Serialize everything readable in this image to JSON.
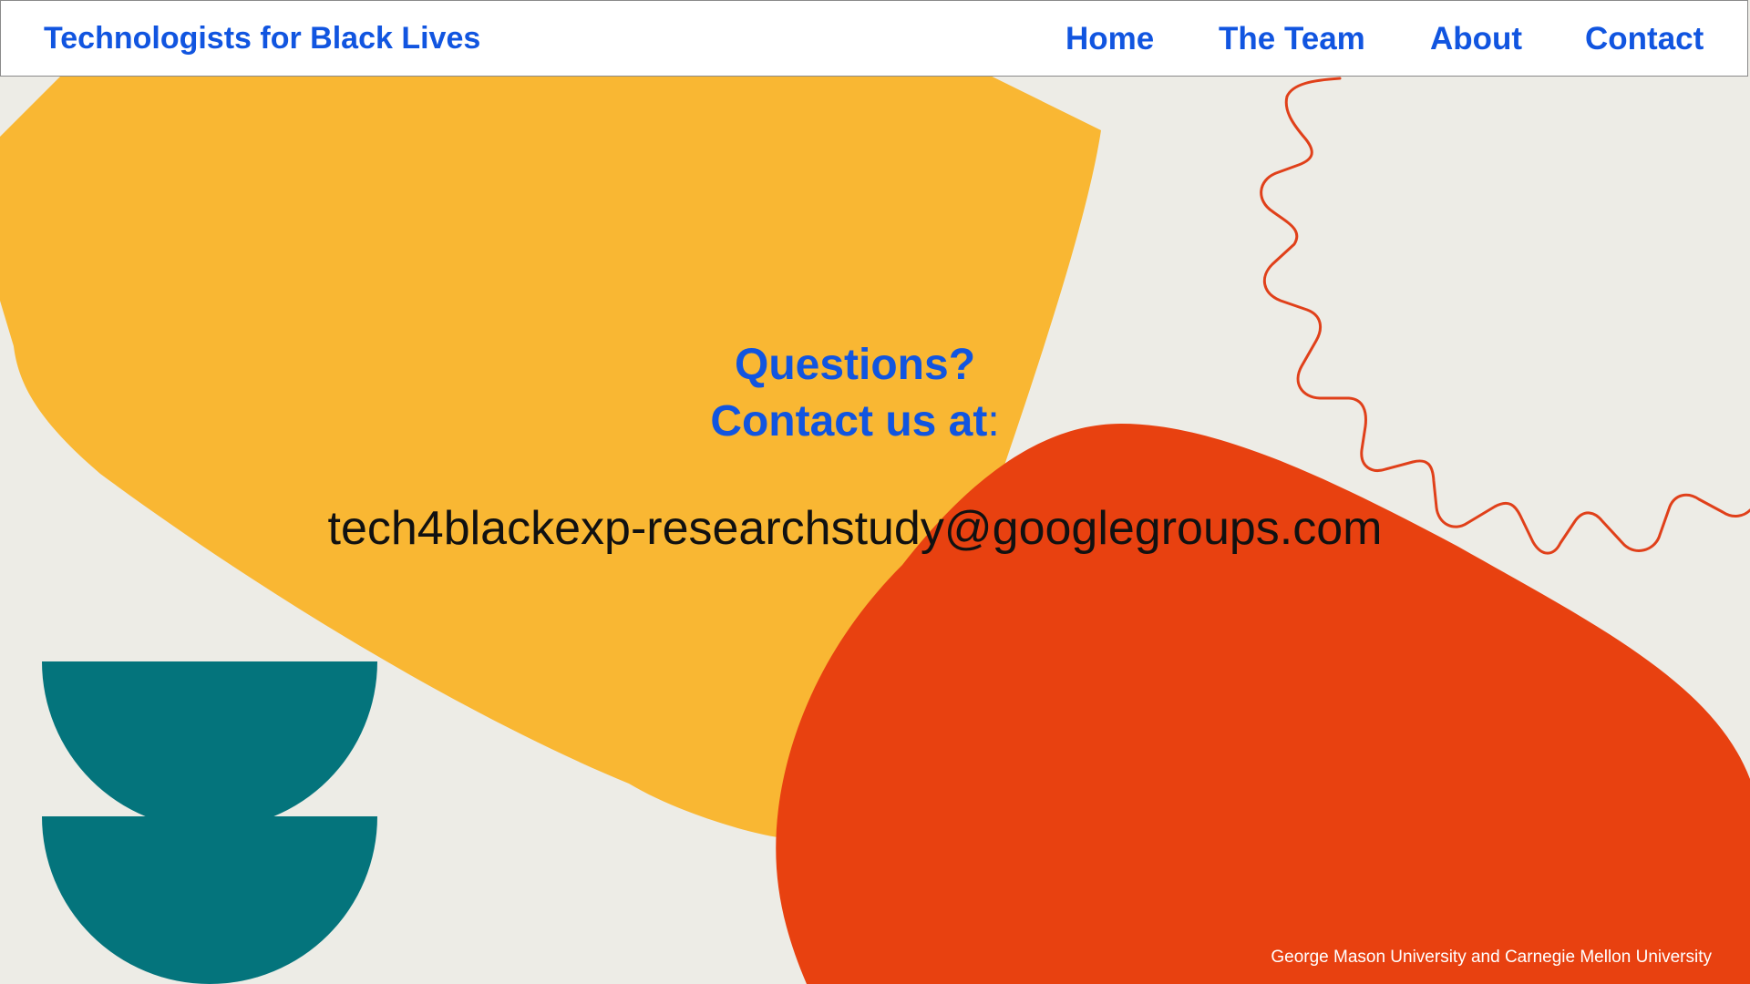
{
  "header": {
    "brand": "Technologists for Black Lives",
    "nav": {
      "home": "Home",
      "team": "The Team",
      "about": "About",
      "contact": "Contact"
    }
  },
  "main": {
    "question": "Questions?",
    "contact_prefix": "Contact us at",
    "contact_colon": ":",
    "email": "tech4blackexp-researchstudy@googlegroups.com"
  },
  "footer": {
    "credit": "George Mason University and Carnegie Mellon University"
  },
  "colors": {
    "background": "#EDECE6",
    "accent_blue": "#1155E0",
    "shape_yellow": "#F9B733",
    "shape_orange": "#E84110",
    "shape_teal": "#04747C",
    "squiggle_red": "#E0401A"
  },
  "decorations": [
    "yellow-blob",
    "orange-blob",
    "teal-half-circles",
    "red-squiggle-line"
  ]
}
